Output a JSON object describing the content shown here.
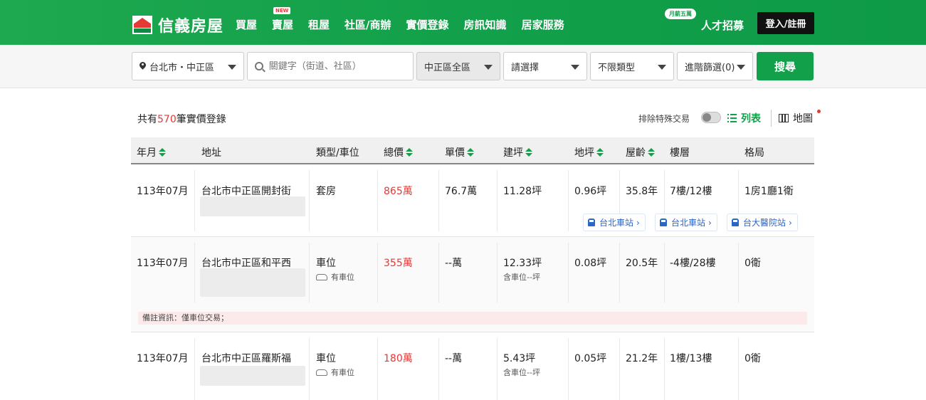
{
  "brand": {
    "name": "信義房屋"
  },
  "nav": {
    "items": [
      {
        "label": "買屋"
      },
      {
        "label": "賣屋",
        "badge": "NEW"
      },
      {
        "label": "租屋"
      },
      {
        "label": "社區/商辦"
      },
      {
        "label": "實價登錄"
      },
      {
        "label": "房訊知識"
      },
      {
        "label": "居家服務"
      }
    ],
    "recruit_badge": "月薪五萬",
    "recruit": "人才招募",
    "login": "登入/註冊"
  },
  "search": {
    "location": "台北市・中正區",
    "keyword_placeholder": "關鍵字（街道、社區）",
    "district": "中正區全區",
    "select": "請選擇",
    "type": "不限類型",
    "advanced": "進階篩選(0)",
    "submit": "搜尋"
  },
  "results": {
    "prefix": "共有",
    "count": "570",
    "suffix": "筆實價登錄",
    "exclude_special": "排除特殊交易",
    "exclude_special_on": false,
    "view_list": "列表",
    "view_map": "地圖"
  },
  "table": {
    "headers": {
      "date": "年月",
      "address": "地址",
      "type": "類型/車位",
      "total": "總價",
      "unit": "單價",
      "building_area": "建坪",
      "land_area": "地坪",
      "age": "屋齡",
      "floor": "樓層",
      "layout": "格局"
    },
    "rows": [
      {
        "date": "113年07月",
        "address": "台北市中正區開封街",
        "type": "套房",
        "total": "865萬",
        "unit": "76.7萬",
        "building_area": "11.28坪",
        "land_area": "0.96坪",
        "age": "35.8年",
        "floor": "7樓/12樓",
        "layout": "1房1廳1衛",
        "stations": [
          "台北車站",
          "台北車站",
          "台大醫院站"
        ]
      },
      {
        "date": "113年07月",
        "address": "台北市中正區和平西",
        "type": "車位",
        "parking": "有車位",
        "total": "355萬",
        "unit": "--萬",
        "building_area": "12.33坪",
        "parking_area": "含車位--坪",
        "land_area": "0.08坪",
        "age": "20.5年",
        "floor": "-4樓/28樓",
        "layout": "0衛",
        "note": "備註資訊：僅車位交易；"
      },
      {
        "date": "113年07月",
        "address": "台北市中正區羅斯福",
        "type": "車位",
        "parking": "有車位",
        "total": "180萬",
        "unit": "--萬",
        "building_area": "5.43坪",
        "parking_area": "含車位--坪",
        "land_area": "0.05坪",
        "age": "21.2年",
        "floor": "1樓/13樓",
        "layout": "0衛"
      }
    ]
  }
}
